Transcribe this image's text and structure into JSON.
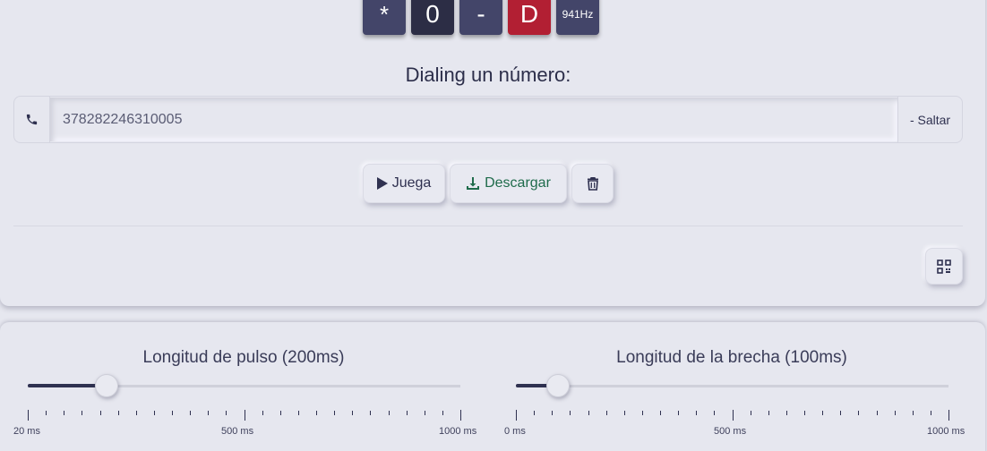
{
  "keypad": {
    "keys": [
      {
        "label": "*",
        "color": "#434569"
      },
      {
        "label": "0",
        "color": "#2c2d45"
      },
      {
        "label": "-",
        "color": "#434569"
      },
      {
        "label": "D",
        "color": "#b21f33"
      },
      {
        "label": "941Hz",
        "color": "#434569"
      }
    ]
  },
  "dialer": {
    "title": "Dialing un número:",
    "phone_icon": "phone-icon",
    "number_value": "378282246310005",
    "skip_label": "- Saltar"
  },
  "actions": {
    "play_label": "Juega",
    "play_icon": "play-icon",
    "download_label": "Descargar",
    "download_icon": "download-icon",
    "delete_icon": "trash-icon",
    "download_color": "#1f6b4b"
  },
  "qr": {
    "icon": "qr-code-icon"
  },
  "sliders": {
    "pulse": {
      "title": "Longitud de pulso (200ms)",
      "value_ms": 200,
      "min_label": "20 ms",
      "mid_label": "500 ms",
      "max_label": "1000 ms"
    },
    "gap": {
      "title": "Longitud de la brecha (100ms)",
      "value_ms": 100,
      "min_label": "0 ms",
      "mid_label": "500 ms",
      "max_label": "1000 ms"
    }
  },
  "colors": {
    "background": "#e6e7ef",
    "text": "#2f3150",
    "accent_red": "#b21f33"
  }
}
